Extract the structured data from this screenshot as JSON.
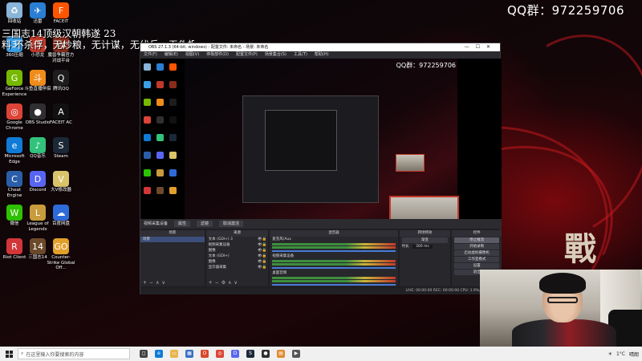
{
  "overlay": {
    "qq_group": "QQ群：972259706",
    "stream_title": "三国志14顶级汉朝韩遂 23",
    "stream_subtitle": "料 不杀俘，无炒粮，无计谋，无伏兵，无伪报，断粮上",
    "zhan": "戰"
  },
  "desktop_icons": [
    {
      "name": "recycle-bin",
      "label": "回收站",
      "color": "#8ab4d8",
      "glyph": "♻"
    },
    {
      "name": "xunlei",
      "label": "迅雷",
      "color": "#2a7fd4",
      "glyph": "✈"
    },
    {
      "name": "faceit",
      "label": "FACEIT",
      "color": "#ff5500",
      "glyph": "F"
    },
    {
      "name": "360-safe",
      "label": "360压缩",
      "color": "#3aa0e6",
      "glyph": "3"
    },
    {
      "name": "xiaoyi",
      "label": "小恐龙",
      "color": "#c0392b",
      "glyph": "D"
    },
    {
      "name": "mota",
      "label": "魔兽争霸官方对战平台",
      "color": "#8a2b1b",
      "glyph": "W"
    },
    {
      "name": "geforce",
      "label": "GeForce Experience",
      "color": "#76b900",
      "glyph": "G"
    },
    {
      "name": "douyu",
      "label": "斗鱼直播伴侣",
      "color": "#f08c1a",
      "glyph": "斗"
    },
    {
      "name": "qq-music",
      "label": "腾讯QQ",
      "color": "#1d1d1d",
      "glyph": "Q"
    },
    {
      "name": "chrome",
      "label": "Google Chrome",
      "color": "#db4437",
      "glyph": "◎"
    },
    {
      "name": "obs",
      "label": "OBS Studio",
      "color": "#302e31",
      "glyph": "●"
    },
    {
      "name": "faceit-ac",
      "label": "FACEIT AC",
      "color": "#111111",
      "glyph": "A"
    },
    {
      "name": "edge",
      "label": "Microsoft Edge",
      "color": "#0f7bd6",
      "glyph": "e"
    },
    {
      "name": "qq-music2",
      "label": "QQ音乐",
      "color": "#31c27c",
      "glyph": "♪"
    },
    {
      "name": "steam",
      "label": "Steam",
      "color": "#1b2838",
      "glyph": "S"
    },
    {
      "name": "cheat-engine",
      "label": "Cheat Engine",
      "color": "#2b5ea8",
      "glyph": "C"
    },
    {
      "name": "discord",
      "label": "Discord",
      "color": "#5865f2",
      "glyph": "D"
    },
    {
      "name": "daxiang",
      "label": "大V修改器",
      "color": "#d9c46a",
      "glyph": "V"
    },
    {
      "name": "wechat",
      "label": "微信",
      "color": "#2dc100",
      "glyph": "W"
    },
    {
      "name": "lol",
      "label": "League of Legends",
      "color": "#c89b3c",
      "glyph": "L"
    },
    {
      "name": "baidu-netdisk",
      "label": "百度网盘",
      "color": "#2e6bd9",
      "glyph": "☁"
    },
    {
      "name": "riot-client",
      "label": "Riot Client",
      "color": "#d13639",
      "glyph": "R"
    },
    {
      "name": "sanguozhi14",
      "label": "三国志14",
      "color": "#6b4a2b",
      "glyph": "14"
    },
    {
      "name": "csgo",
      "label": "Counter-Strike Global Off...",
      "color": "#e1a02b",
      "glyph": "GO"
    }
  ],
  "obs": {
    "title": "OBS 27.1.3 (64-bit, windows) - 配置文件: 未命名 - 场景: 未命名",
    "menu": [
      "文件(F)",
      "编辑(E)",
      "视图(V)",
      "停靠部件(D)",
      "配置文件(P)",
      "场景集合(S)",
      "工具(T)",
      "帮助(H)"
    ],
    "preview_qq": "QQ群：972259706",
    "source_bar": {
      "capture": "视频采集设备",
      "props": "属性",
      "filters": "滤镜",
      "deactivate": "取消激活"
    },
    "docks": {
      "scenes_header": "场景",
      "scenes": [
        "场景"
      ],
      "sources_header": "来源",
      "sources": [
        "文本 (GDI+) 3",
        "视频采集设备",
        "图像",
        "文本 (GDI+)",
        "图像",
        "显示器采集"
      ],
      "mixer_header": "混音器",
      "mixer": [
        "麦克风/Aux",
        "视频采集设备",
        "桌面音频"
      ],
      "transitions_header": "转场特效",
      "transition_type": "渐变",
      "duration_label": "时长",
      "duration_value": "300 ms",
      "controls_header": "控件",
      "controls": [
        "停止推流",
        "开始录制",
        "启动虚拟摄像机",
        "工作室模式",
        "设置",
        "退出"
      ]
    },
    "status": "LIVE: 00:00:00   REC: 00:00:00   CPU: 1.9%, 60.00 fps"
  },
  "taskbar": {
    "search_placeholder": "在这里输入你要搜索的内容",
    "weather": "1°C",
    "tray_label": "晴朗",
    "pinned": [
      {
        "name": "task-view",
        "color": "#444444",
        "glyph": "◻"
      },
      {
        "name": "edge",
        "color": "#0f7bd6",
        "glyph": "e"
      },
      {
        "name": "explorer",
        "color": "#e8b64a",
        "glyph": "▭"
      },
      {
        "name": "store",
        "color": "#3a6fc4",
        "glyph": "▦"
      },
      {
        "name": "office",
        "color": "#d9472b",
        "glyph": "O"
      },
      {
        "name": "chrome",
        "color": "#db4437",
        "glyph": "◎"
      },
      {
        "name": "discord",
        "color": "#5865f2",
        "glyph": "D"
      },
      {
        "name": "steam",
        "color": "#1b2838",
        "glyph": "S"
      },
      {
        "name": "obs",
        "color": "#302e31",
        "glyph": "●"
      },
      {
        "name": "file",
        "color": "#e08a2b",
        "glyph": "▤"
      },
      {
        "name": "vlc",
        "color": "#555555",
        "glyph": "▶"
      }
    ]
  }
}
